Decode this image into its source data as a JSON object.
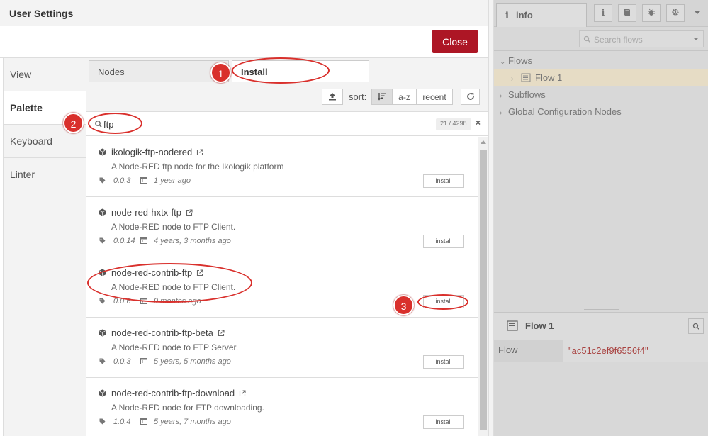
{
  "dialog": {
    "title": "User Settings",
    "close_label": "Close",
    "tabs": [
      {
        "label": "View"
      },
      {
        "label": "Palette"
      },
      {
        "label": "Keyboard"
      },
      {
        "label": "Linter"
      }
    ]
  },
  "palette": {
    "tabs": [
      {
        "label": "Nodes"
      },
      {
        "label": "Install"
      }
    ],
    "sort_label": "sort:",
    "sort_options": {
      "az": "a-z",
      "recent": "recent"
    },
    "search_value": "ftp",
    "result_count": "21 / 4298",
    "clear_label": "×",
    "install_label": "install",
    "items": [
      {
        "name": "ikologik-ftp-nodered",
        "desc": "A Node-RED ftp node for the Ikologik platform",
        "version": "0.0.3",
        "date": "1 year ago"
      },
      {
        "name": "node-red-hxtx-ftp",
        "desc": "A Node-RED node to FTP Client.",
        "version": "0.0.14",
        "date": "4 years, 3 months ago"
      },
      {
        "name": "node-red-contrib-ftp",
        "desc": "A Node-RED node to FTP Client.",
        "version": "0.0.6",
        "date": "9 months ago"
      },
      {
        "name": "node-red-contrib-ftp-beta",
        "desc": "A Node-RED node to FTP Server.",
        "version": "0.0.3",
        "date": "5 years, 5 months ago"
      },
      {
        "name": "node-red-contrib-ftp-download",
        "desc": "A Node-RED node for FTP downloading.",
        "version": "1.0.4",
        "date": "5 years, 7 months ago"
      }
    ]
  },
  "annotations": {
    "one": "1",
    "two": "2",
    "three": "3"
  },
  "info": {
    "tab_label": "info",
    "search_placeholder": "Search flows",
    "tree": {
      "flows": "Flows",
      "flow1": "Flow 1",
      "subflows": "Subflows",
      "global": "Global Configuration Nodes"
    },
    "bottom_title": "Flow 1",
    "table": {
      "key": "Flow",
      "value": "\"ac51c2ef9f6556f4\""
    }
  },
  "colors": {
    "close_button": "#ad1625",
    "annotation": "#d9302c",
    "highlight_row": "#e6dcc5"
  }
}
